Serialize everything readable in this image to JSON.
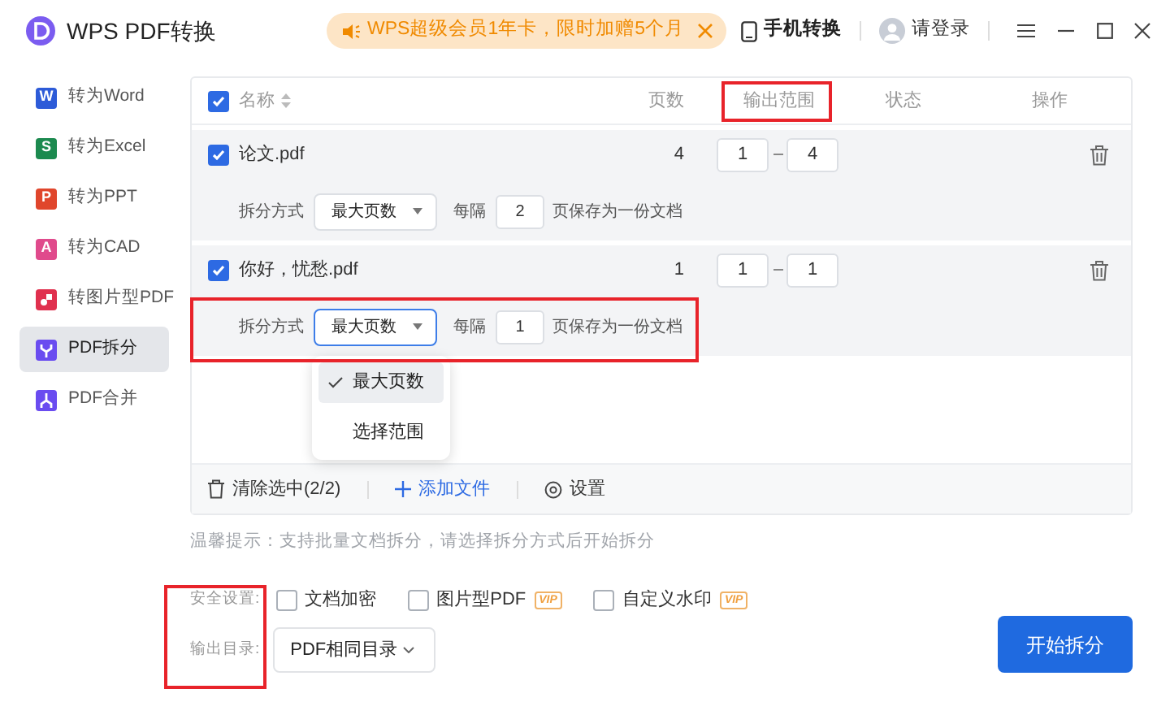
{
  "app": {
    "title": "WPS PDF转换"
  },
  "promo": {
    "text": "WPS超级会员1年卡，限时加赠5个月"
  },
  "mobile": {
    "label": "手机转换"
  },
  "account": {
    "label": "请登录"
  },
  "sidebar": {
    "items": [
      {
        "label": "转为Word",
        "kind": "letter",
        "letter": "W",
        "color": "#2d5bd8",
        "selected": false
      },
      {
        "label": "转为Excel",
        "kind": "letter",
        "letter": "S",
        "color": "#1c8a4f",
        "selected": false
      },
      {
        "label": "转为PPT",
        "kind": "letter",
        "letter": "P",
        "color": "#e0462c",
        "selected": false
      },
      {
        "label": "转为CAD",
        "kind": "letter",
        "letter": "A",
        "color": "#e04a8c",
        "selected": false
      },
      {
        "label": "转图片型PDF",
        "kind": "image",
        "color": "#e0304e",
        "selected": false
      },
      {
        "label": "PDF拆分",
        "kind": "split",
        "color": "#6a4cf0",
        "selected": true
      },
      {
        "label": "PDF合并",
        "kind": "merge",
        "color": "#6a4cf0",
        "selected": false
      }
    ]
  },
  "table": {
    "all_checked": true,
    "columns": [
      {
        "label": "名称",
        "sortable": true
      },
      {
        "label": "页数",
        "sortable": false
      },
      {
        "label": "输出范围",
        "sortable": false
      },
      {
        "label": "状态",
        "sortable": false
      },
      {
        "label": "操作",
        "sortable": false
      }
    ],
    "rows": [
      {
        "name": "论文.pdf",
        "checked": true,
        "pages": "4",
        "range_from": "1",
        "range_to": "4",
        "split_label": "拆分方式",
        "split_mode": "最大页数",
        "focused": false,
        "every_label": "每隔",
        "every": "2",
        "suffix": "页保存为一份文档"
      },
      {
        "name": "你好，忧愁.pdf",
        "checked": true,
        "pages": "1",
        "range_from": "1",
        "range_to": "1",
        "split_label": "拆分方式",
        "split_mode": "最大页数",
        "focused": true,
        "every_label": "每隔",
        "every": "1",
        "suffix": "页保存为一份文档"
      }
    ],
    "dropdown": {
      "options": [
        {
          "label": "最大页数",
          "selected": true
        },
        {
          "label": "选择范围",
          "selected": false
        }
      ]
    },
    "footer": {
      "clear": "清除选中(2/2)",
      "add": "添加文件",
      "settings": "设置"
    }
  },
  "tip": "温馨提示：支持批量文档拆分，请选择拆分方式后开始拆分",
  "security": {
    "label": "安全设置:",
    "options": [
      {
        "label": "文档加密",
        "checked": false
      },
      {
        "label": "图片型PDF",
        "checked": false,
        "badge": "VIP"
      },
      {
        "label": "自定义水印",
        "checked": false,
        "badge": "VIP"
      }
    ]
  },
  "output": {
    "label": "输出目录:",
    "value": "PDF相同目录"
  },
  "start_button": "开始拆分"
}
